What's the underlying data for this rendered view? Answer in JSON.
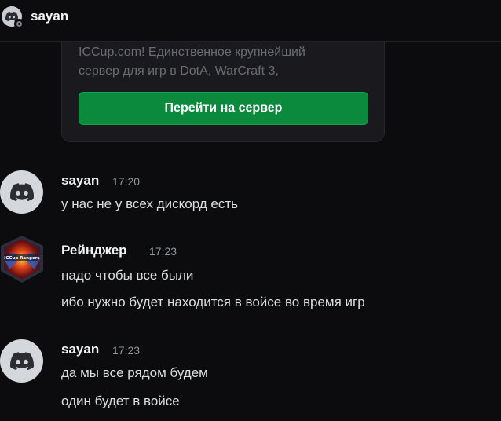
{
  "header": {
    "title": "sayan"
  },
  "embed": {
    "description_line1": "ICCup.com! Единственное крупнейший",
    "description_line2": "сервер для игр в DotA, WarCraft 3,",
    "button_label": "Перейти на сервер"
  },
  "messages": [
    {
      "author": "sayan",
      "time": "17:20",
      "lines": [
        "у нас не у всех дискорд есть"
      ],
      "avatar": "discord-default-icon"
    },
    {
      "author": "Рейнджер",
      "time": "17:23",
      "lines": [
        "надо чтобы все были",
        "ибо нужно будет находится в войсе во время игр"
      ],
      "avatar": "iccup-rangers-logo",
      "avatar_text": "ICCup Rangers"
    },
    {
      "author": "sayan",
      "time": "17:23",
      "lines": [
        "да мы все рядом будем",
        "один будет в войсе"
      ],
      "avatar": "discord-default-icon"
    }
  ],
  "colors": {
    "background": "#0c0c0e",
    "embed_bg": "#1a1a1e",
    "button_green": "#0b8a3e",
    "timestamp": "#93969c"
  }
}
